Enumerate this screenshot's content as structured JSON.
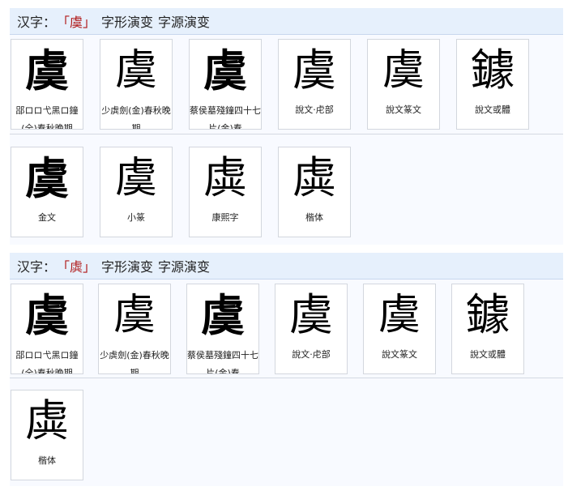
{
  "panel_a": {
    "title_prefix": "汉字：",
    "title_char": "「虞」",
    "title_tab1": "字形演变",
    "title_tab2": "字源演变",
    "row1": [
      {
        "glyph": "虞",
        "caption": "郘ロロ弋黑ロ鐘(全)春秋晚期"
      },
      {
        "glyph": "虞",
        "caption": "少虡劍(金)春秋晚期"
      },
      {
        "glyph": "虞",
        "caption": "蔡侯墓殘鐘四十七片(金)春"
      },
      {
        "glyph": "虞",
        "caption": "說文‧虍部"
      },
      {
        "glyph": "虞",
        "caption": "說文篆文"
      },
      {
        "glyph": "鐻",
        "caption": "說文或體"
      }
    ],
    "row2": [
      {
        "glyph": "虞",
        "caption": "金文"
      },
      {
        "glyph": "虞",
        "caption": "小篆"
      },
      {
        "glyph": "虡",
        "caption": "康熙字"
      },
      {
        "glyph": "虡",
        "caption": "楷体"
      }
    ]
  },
  "panel_b": {
    "title_prefix": "汉字：",
    "title_char": "「虡」",
    "title_tab1": "字形演变",
    "title_tab2": "字源演变",
    "row1": [
      {
        "glyph": "虞",
        "caption": "郘ロロ弋黑ロ鐘(全)春秋晚期"
      },
      {
        "glyph": "虞",
        "caption": "少虡劍(金)春秋晚期"
      },
      {
        "glyph": "虞",
        "caption": "蔡侯墓殘鐘四十七片(金)春"
      },
      {
        "glyph": "虞",
        "caption": "說文‧虍部"
      },
      {
        "glyph": "虞",
        "caption": "說文篆文"
      },
      {
        "glyph": "鐻",
        "caption": "說文或體"
      }
    ],
    "row2": [
      {
        "glyph": "虡",
        "caption": "楷体"
      }
    ]
  }
}
